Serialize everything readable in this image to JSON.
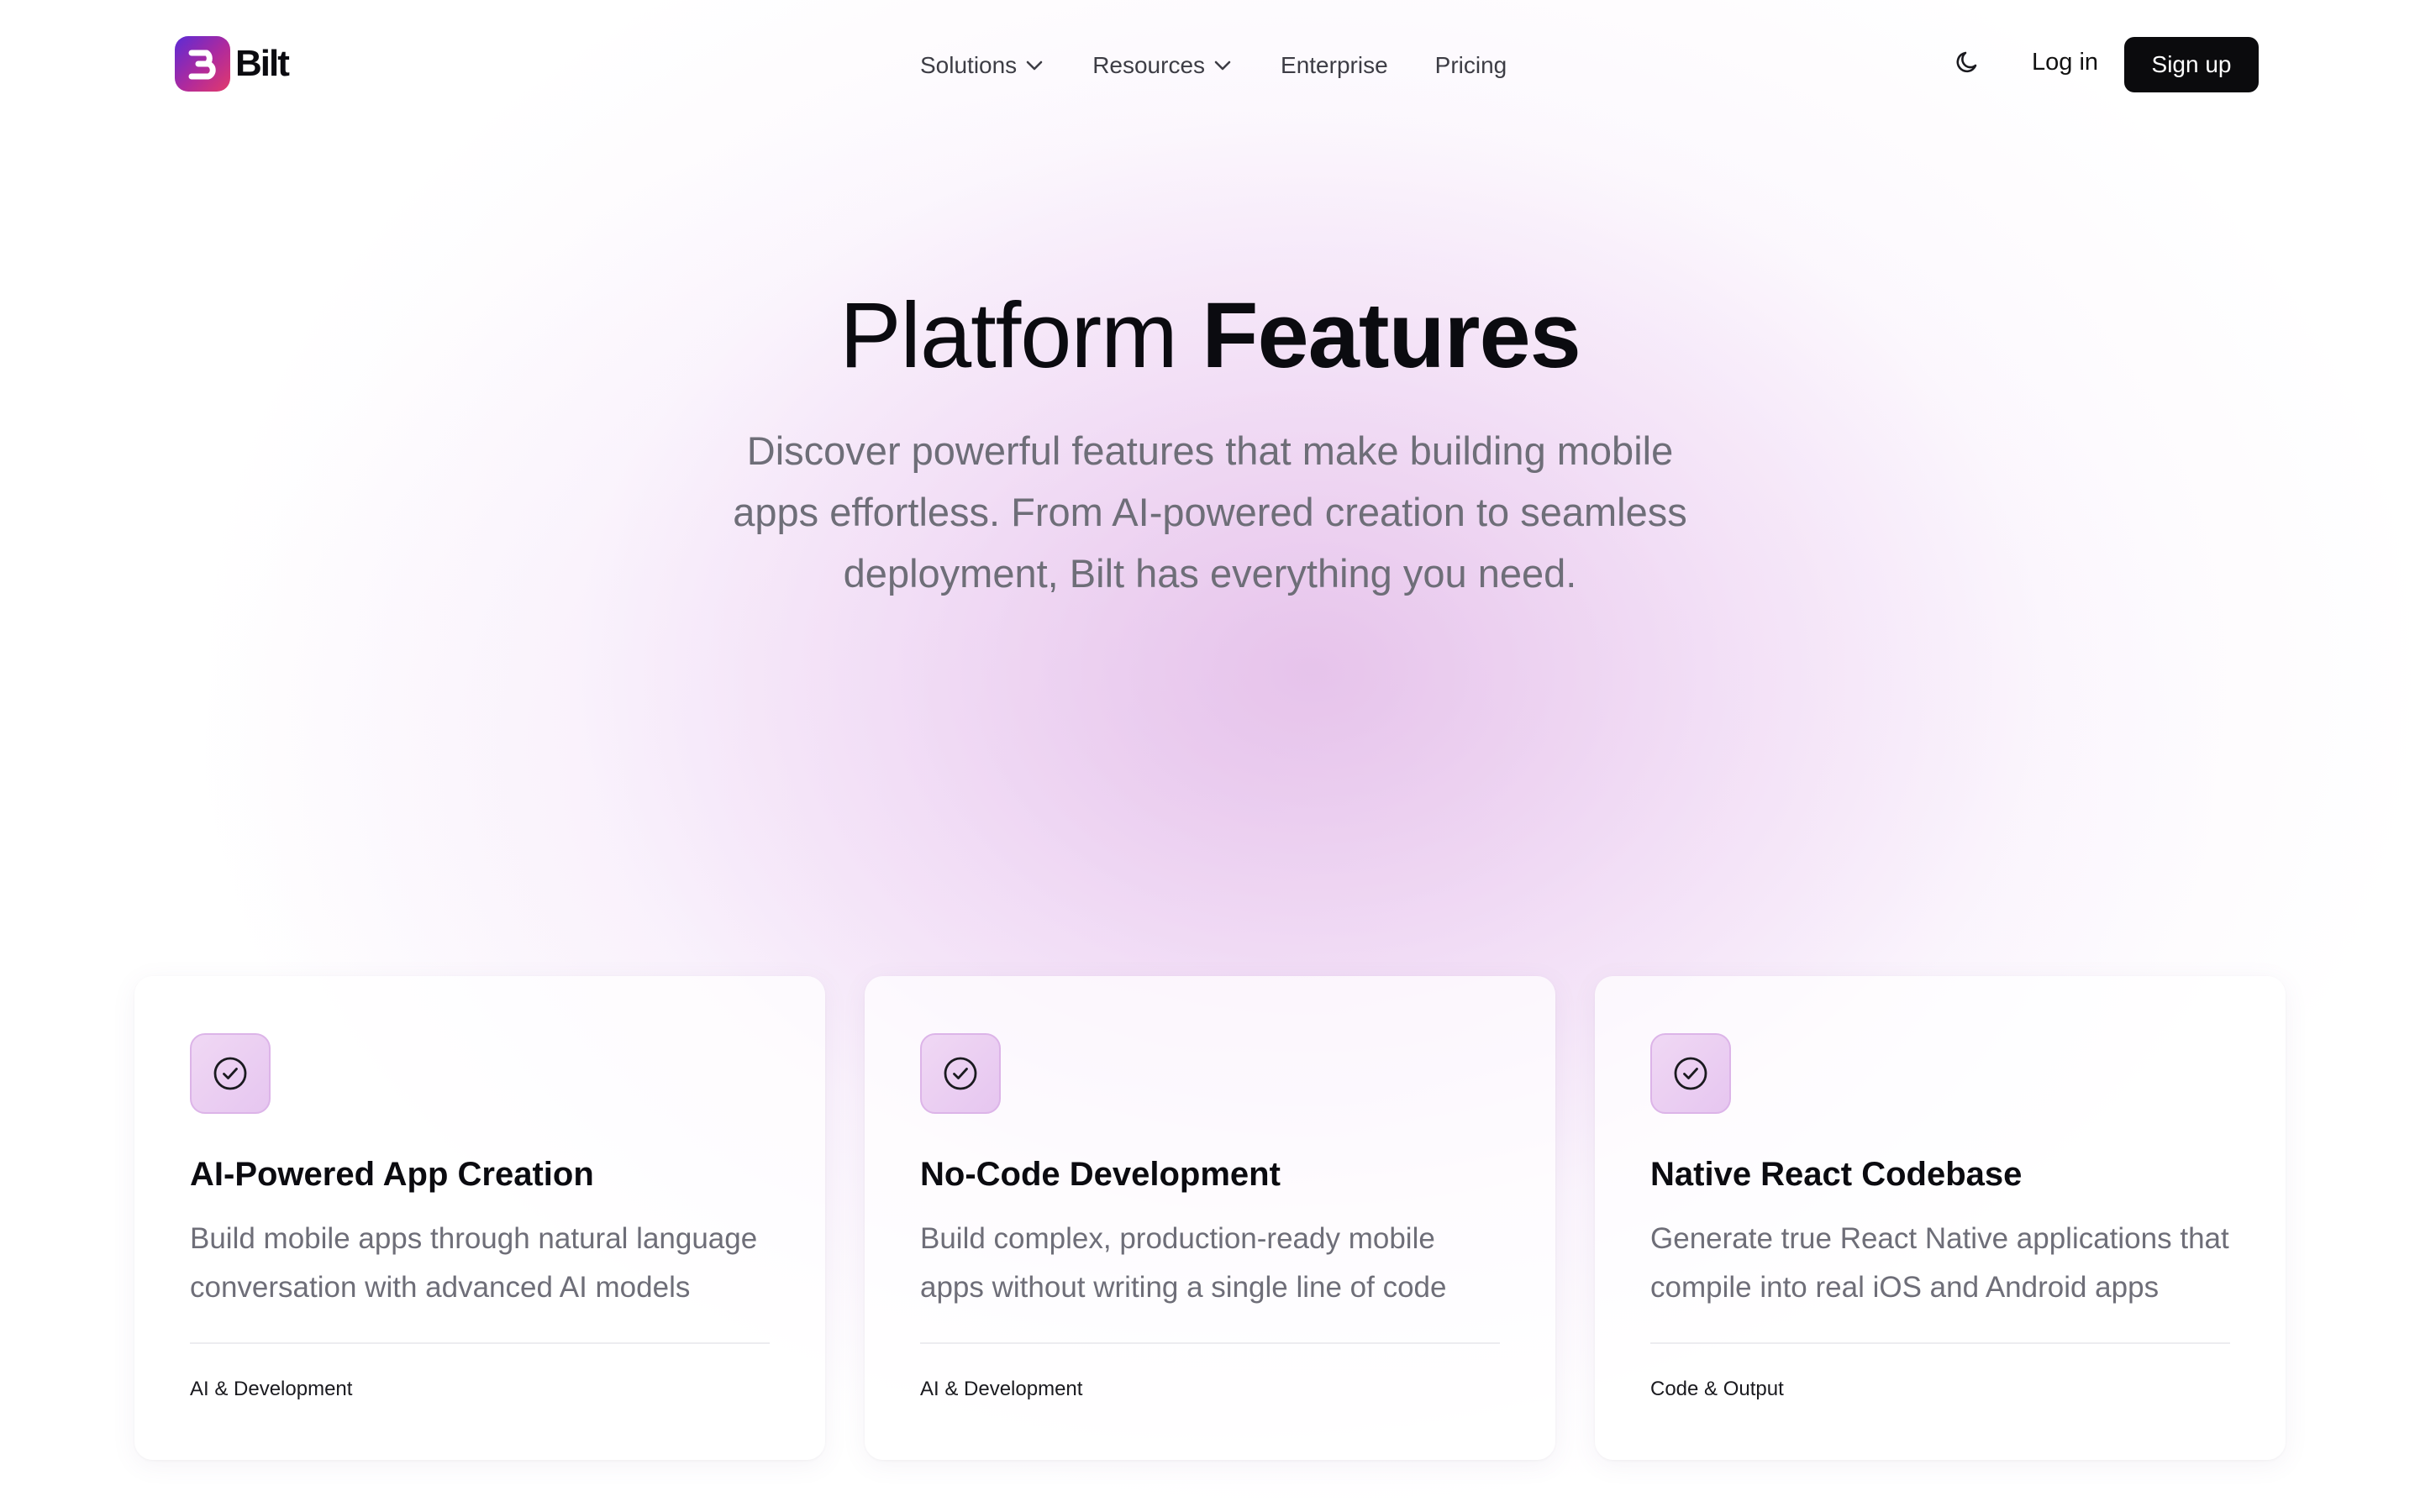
{
  "nav": {
    "logo_text": "Bilt",
    "links": [
      {
        "label": "Solutions",
        "has_dropdown": true
      },
      {
        "label": "Resources",
        "has_dropdown": true
      },
      {
        "label": "Enterprise",
        "has_dropdown": false
      },
      {
        "label": "Pricing",
        "has_dropdown": false
      }
    ],
    "theme_icon": "moon-icon",
    "login_label": "Log in",
    "signup_label": "Sign up"
  },
  "hero": {
    "title_regular": "Platform",
    "title_bold": "Features",
    "subtitle": "Discover powerful features that make building mobile apps effortless. From AI-powered creation to seamless deployment, Bilt has everything you need."
  },
  "cards": [
    {
      "icon": "check-circle-icon",
      "title": "AI-Powered App Creation",
      "description": "Build mobile apps through natural language conversation with advanced AI models",
      "tag": "AI & Development"
    },
    {
      "icon": "check-circle-icon",
      "title": "No-Code Development",
      "description": "Build complex, production-ready mobile apps without writing a single line of code",
      "tag": "AI & Development"
    },
    {
      "icon": "check-circle-icon",
      "title": "Native React Codebase",
      "description": "Generate true React Native applications that compile into real iOS and Android apps",
      "tag": "Code & Output"
    }
  ],
  "colors": {
    "brand_gradient_start": "#5b2bd6",
    "brand_gradient_end": "#e23a6b",
    "primary_button": "#0b0b0d",
    "icon_tile": "#ecd0f2",
    "muted_text": "#6e6e78"
  }
}
